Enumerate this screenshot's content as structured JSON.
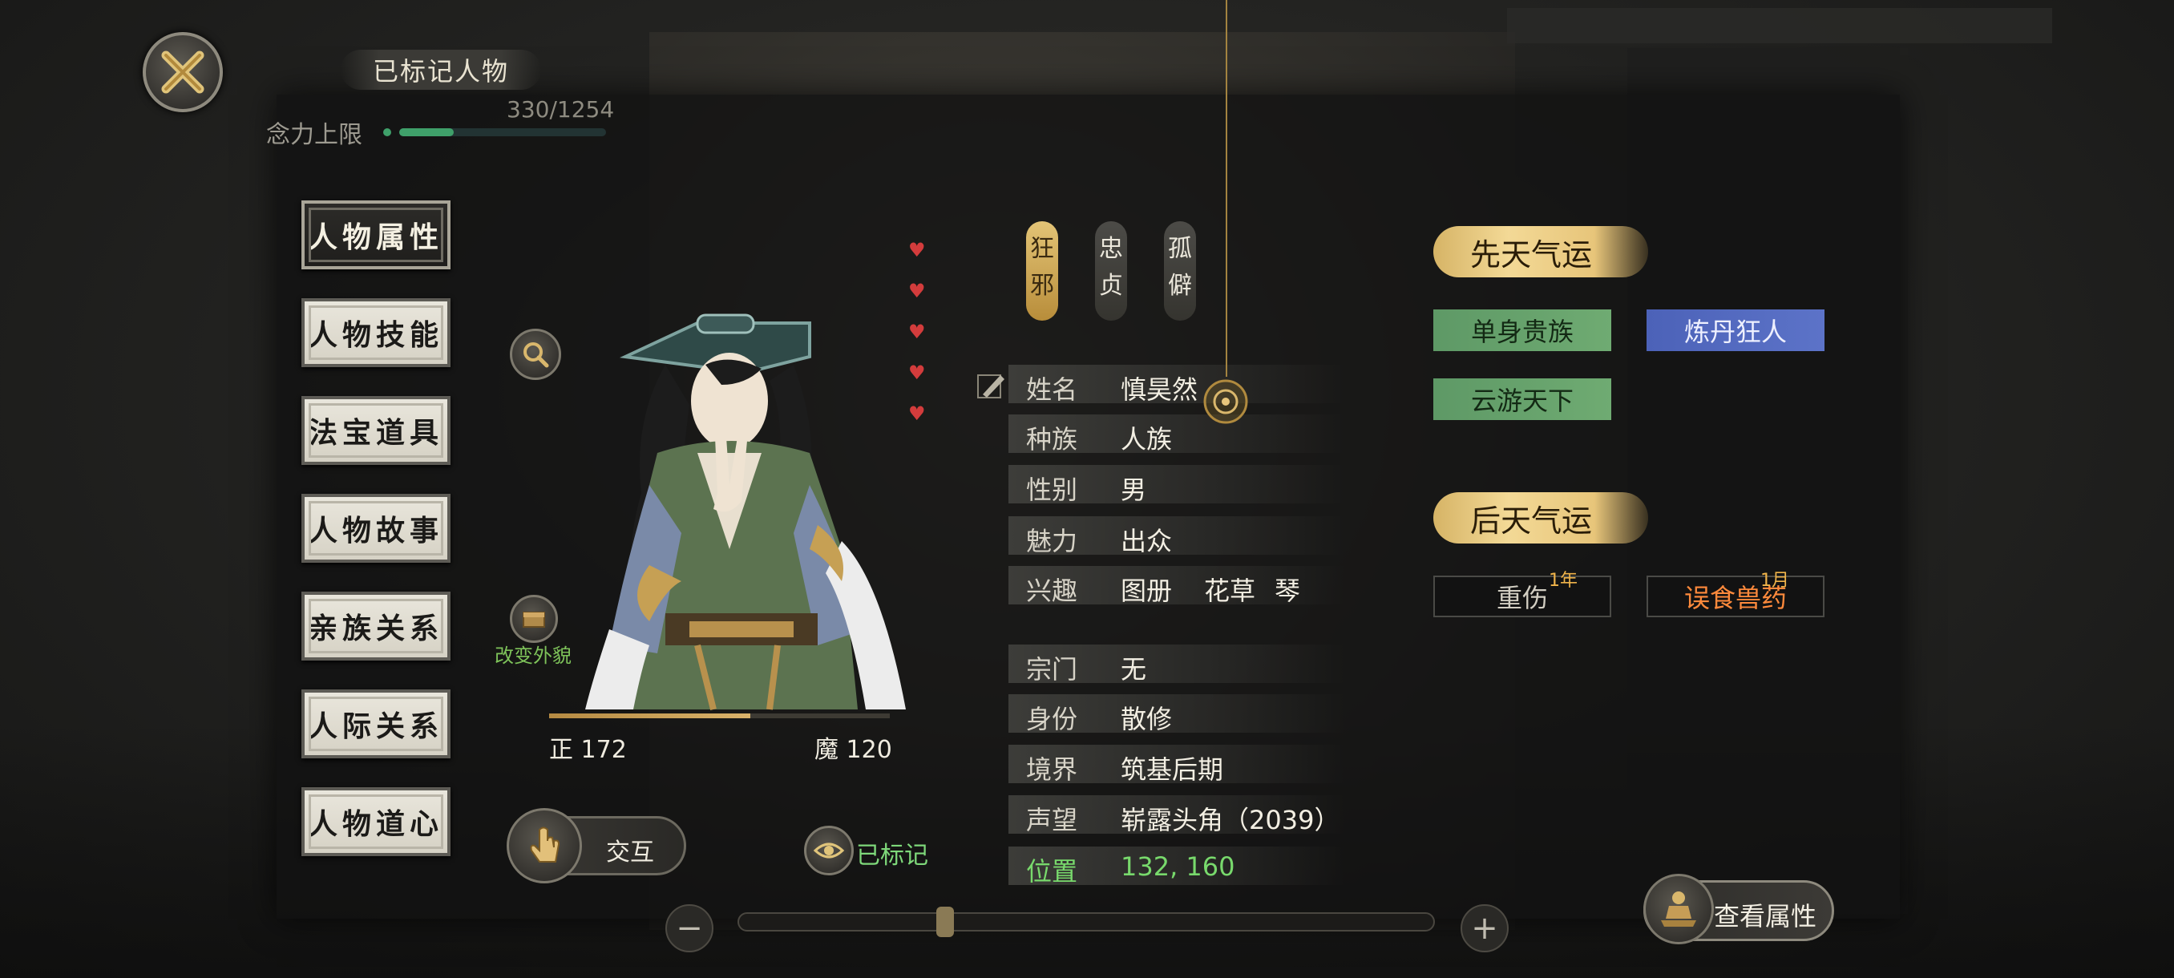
{
  "header": {
    "marked_title": "已标记人物",
    "mind_label": "念力上限",
    "mind_value": "330/1254",
    "mind_fraction": 0.263
  },
  "tabs": [
    {
      "label": "人物属性",
      "active": true
    },
    {
      "label": "人物技能",
      "active": false
    },
    {
      "label": "法宝道具",
      "active": false
    },
    {
      "label": "人物故事",
      "active": false
    },
    {
      "label": "亲族关系",
      "active": false
    },
    {
      "label": "人际关系",
      "active": false
    },
    {
      "label": "人物道心",
      "active": false
    }
  ],
  "appearance": {
    "change_label": "改变外貌"
  },
  "stats": {
    "righteous": "正 172",
    "demonic": "魔 120",
    "righteous_fraction": 0.59
  },
  "actions": {
    "interact_label": "交互",
    "marked_label": "已标记"
  },
  "traits": [
    "狂邪",
    "忠贞",
    "孤僻"
  ],
  "hearts": 5,
  "info": {
    "name": {
      "label": "姓名",
      "value": "慎昊然"
    },
    "race": {
      "label": "种族",
      "value": "人族"
    },
    "gender": {
      "label": "性别",
      "value": "男"
    },
    "charm": {
      "label": "魅力",
      "value": "出众"
    },
    "hobby": {
      "label": "兴趣",
      "values": [
        "图册",
        "花草",
        "琴"
      ]
    },
    "sect": {
      "label": "宗门",
      "value": "无"
    },
    "identity": {
      "label": "身份",
      "value": "散修"
    },
    "realm": {
      "label": "境界",
      "value": "筑基后期"
    },
    "fame": {
      "label": "声望",
      "value": "崭露头角（2039）"
    },
    "position": {
      "label": "位置",
      "value": "132, 160"
    }
  },
  "fortune": {
    "innate_title": "先天气运",
    "innate": [
      "单身贵族",
      "炼丹狂人",
      "云游天下"
    ],
    "acquired_title": "后天气运",
    "acquired": [
      {
        "name": "重伤",
        "duration": "1年"
      },
      {
        "name": "误食兽药",
        "duration": "1月"
      }
    ]
  },
  "bottom": {
    "view_attr_label": "查看属性",
    "zoom_minus": "−",
    "zoom_plus": "+"
  },
  "colors": {
    "gold": "#e7c57a",
    "green_fortune": "#6fab72",
    "blue_fortune": "#5c73c8",
    "orange_text": "#ff8a3c",
    "green_text": "#78d96c"
  }
}
